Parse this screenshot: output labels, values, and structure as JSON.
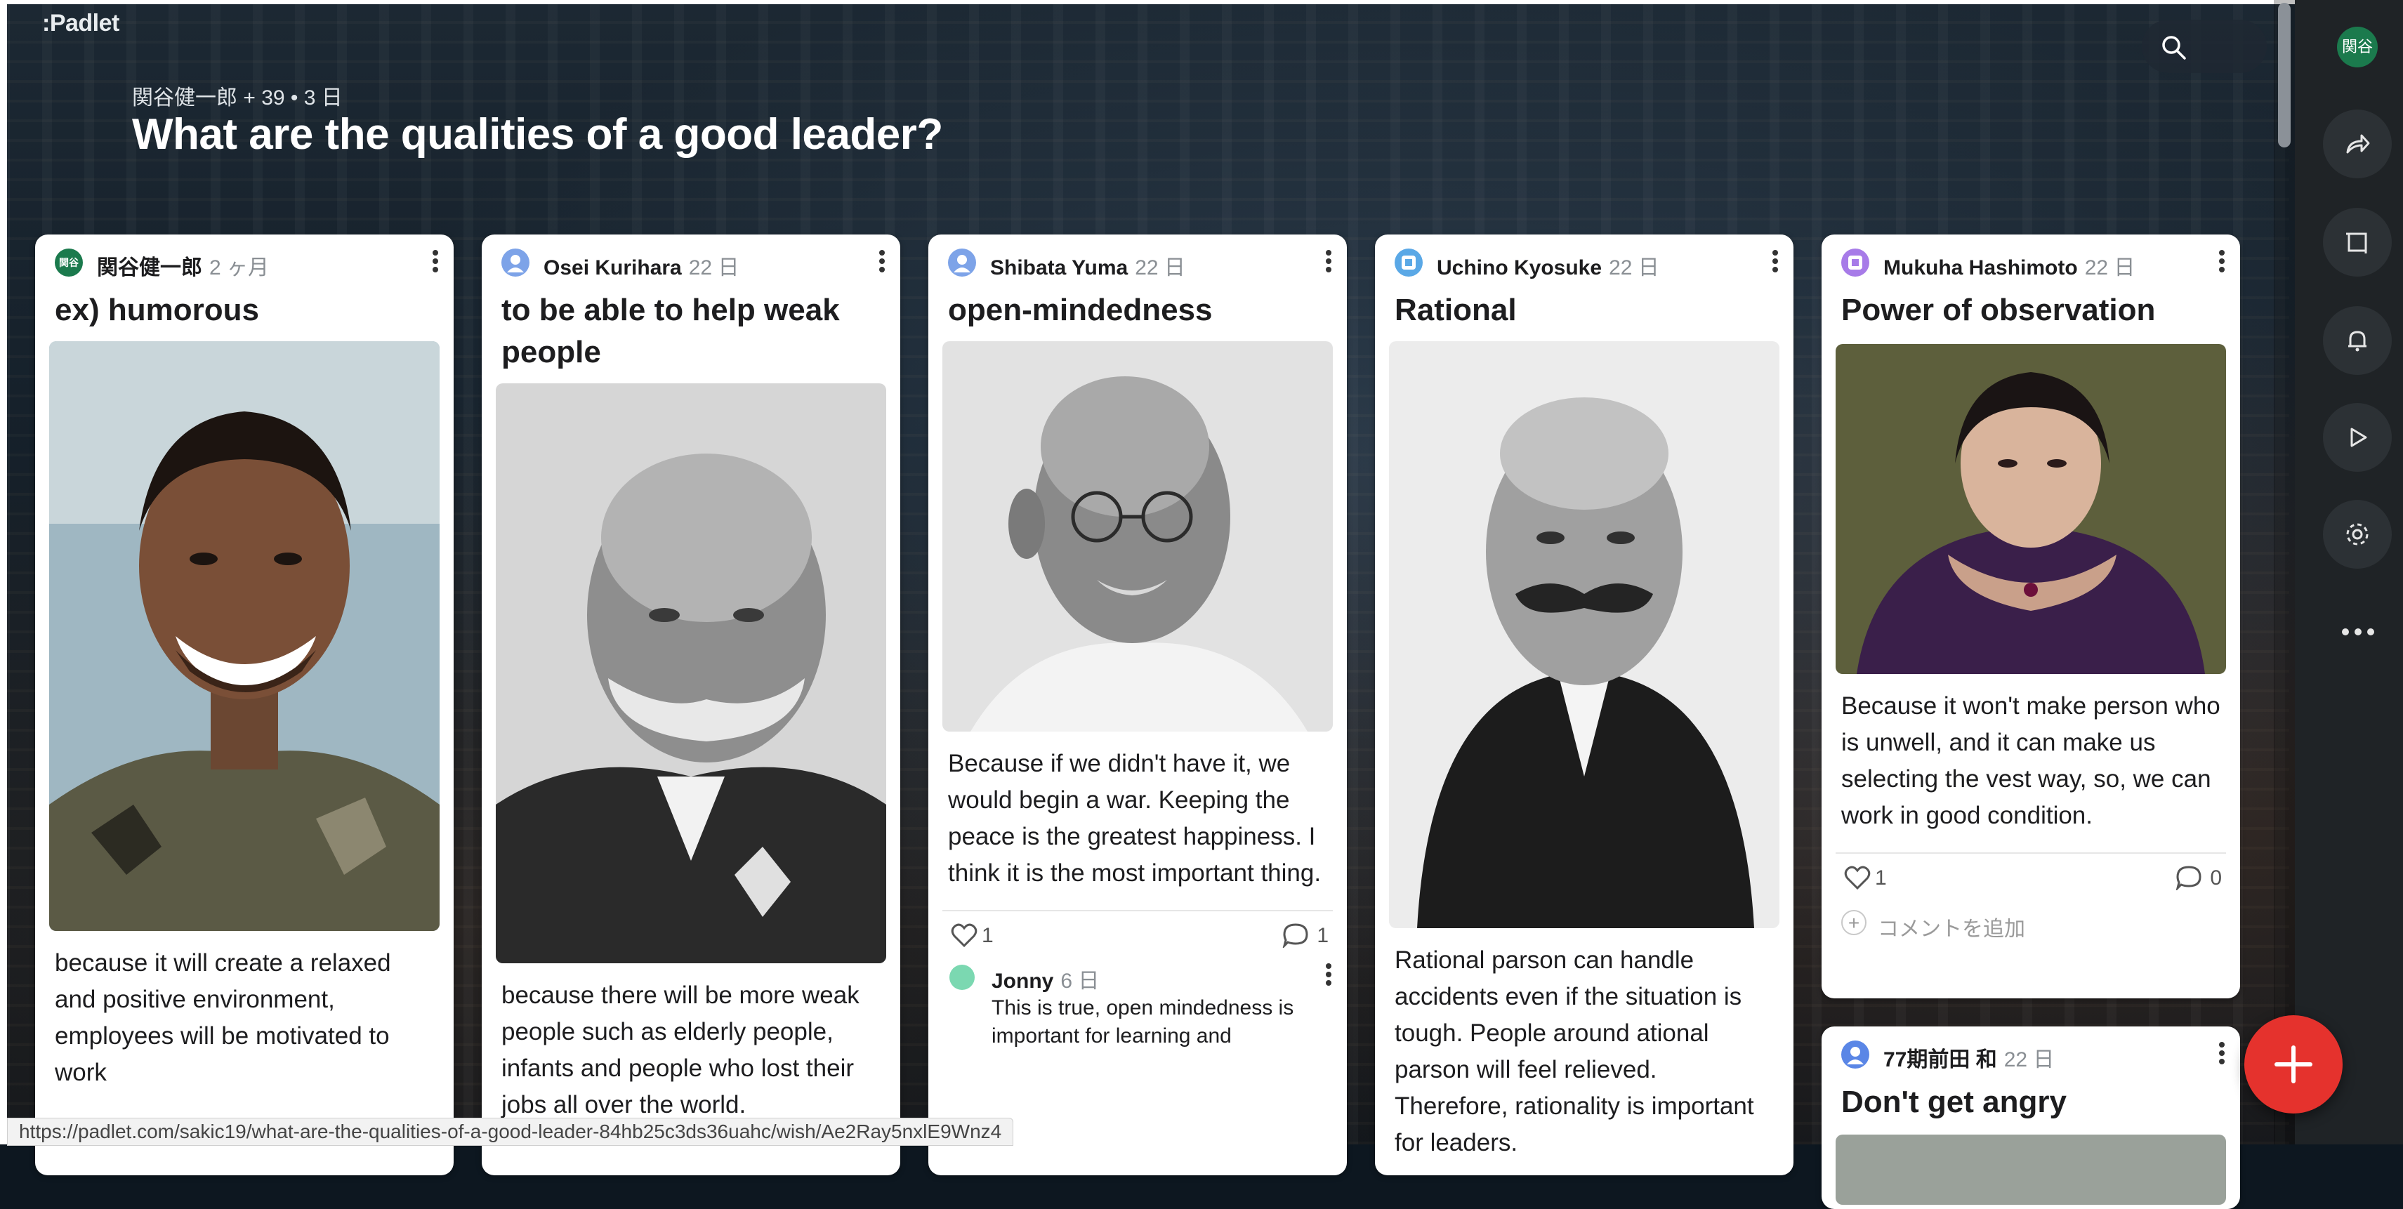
{
  "app": {
    "logo": ":Padlet"
  },
  "header": {
    "meta": "関谷健一郎 + 39 • 3 日",
    "title": "What are the qualities of a good leader?"
  },
  "user_avatar": "関谷",
  "status_url": "https://padlet.com/sakic19/what-are-the-qualities-of-a-good-leader-84hb25c3ds36uahc/wish/Ae2Ray5nxlE9Wnz4",
  "cards": [
    {
      "author": "関谷健一郎",
      "ago": "2 ヶ月",
      "avatar_text": "関谷",
      "avatar_color": "#1b7a4d",
      "title": "ex) humorous",
      "image_subject": "smiling-man-portrait",
      "text": "because it will create a relaxed and positive environment, employees will be motivated to work"
    },
    {
      "author": "Osei Kurihara",
      "ago": "22 日",
      "avatar_color": "#7da3e8",
      "title": "to be able to help weak people",
      "image_subject": "bald-man-mustache-bw-portrait",
      "text": "because there will be more weak people such as elderly people, infants and people who lost their jobs all over the world."
    },
    {
      "author": "Shibata Yuma",
      "ago": "22 日",
      "avatar_color": "#7da3e8",
      "title": "open-mindedness",
      "image_subject": "elderly-man-glasses-bw-portrait",
      "text": "Because if we didn't have it, we would begin a  war. Keeping the peace is the greatest happiness. I think it is the most important thing.",
      "likes": "1",
      "comments": "1",
      "comment": {
        "author": "Jonny",
        "ago": "6 日",
        "text": "This is true, open mindedness is important for learning and"
      }
    },
    {
      "author": "Uchino Kyosuke",
      "ago": "22 日",
      "avatar_color": "#5aa8e6",
      "title": "Rational",
      "image_subject": "mustached-statesman-bw-portrait",
      "text": "Rational parson can handle accidents even if the situation is tough. People around ational parson will feel relieved. Therefore, rationality is important for leaders."
    },
    {
      "author": "Mukuha Hashimoto",
      "ago": "22 日",
      "avatar_color": "#a77be8",
      "title": "Power of observation",
      "image_subject": "woman-purple-dress-portrait",
      "text": "Because it won't make person who is unwell, and it can make us selecting the vest way, so, we can work in good condition.",
      "likes": "1",
      "comments": "0",
      "add_comment": "コメントを追加"
    },
    {
      "author": "77期前田 和",
      "ago": "22 日",
      "avatar_color": "#5a86e6",
      "title": "Don't get angry"
    }
  ],
  "colors": {
    "fab": "#e5322d",
    "rail": "#1f2326"
  }
}
